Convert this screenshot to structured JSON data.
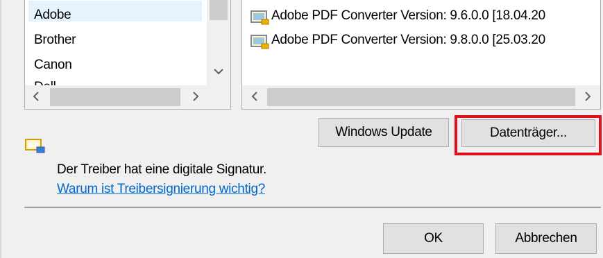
{
  "manufacturers": {
    "items": [
      "Adobe",
      "Brother",
      "Canon",
      "Dell"
    ],
    "selected": "Adobe"
  },
  "models": {
    "items": [
      "Adobe PDF Converter Version: 9.6.0.0 [18.04.20",
      "Adobe PDF Converter Version: 9.8.0.0 [25.03.20"
    ]
  },
  "buttons": {
    "windows_update": "Windows Update",
    "disk": "Datenträger...",
    "ok": "OK",
    "cancel": "Abbrechen"
  },
  "signature": {
    "text": "Der Treiber hat eine digitale Signatur.",
    "link": "Warum ist Treibersignierung wichtig?"
  },
  "colors": {
    "highlight": "#e0101c",
    "link": "#0066cc"
  }
}
